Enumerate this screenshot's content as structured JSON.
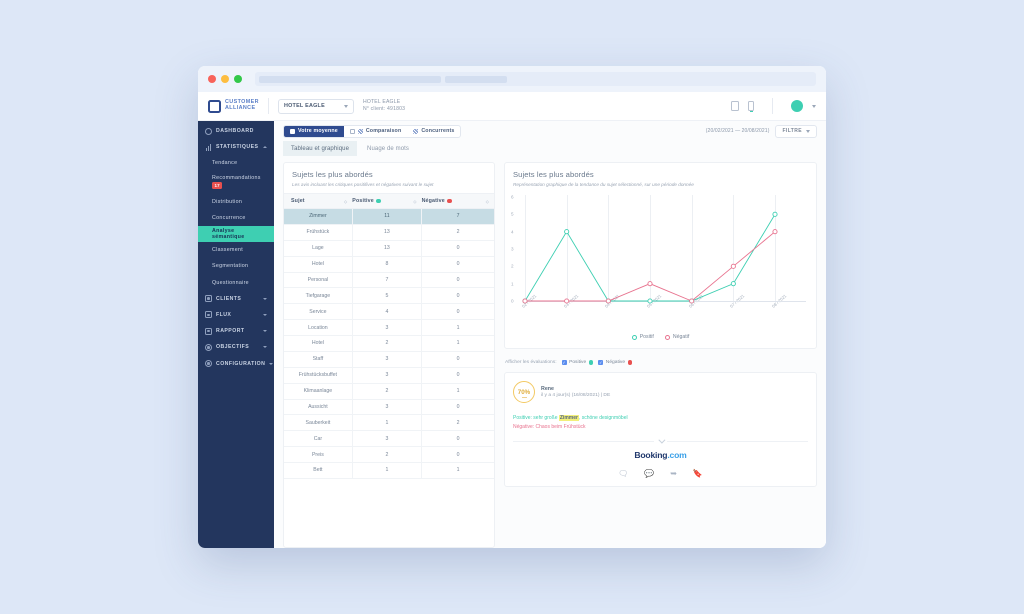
{
  "window": {
    "url_placeholder": ""
  },
  "topbar": {
    "logo_line1": "CUSTOMER",
    "logo_line2": "ALLIANCE",
    "hotel_selector": "HOTEL EAGLE",
    "hotel_name": "HOTEL EAGLE",
    "client_number": "N° client: 491803"
  },
  "sidebar": {
    "items": [
      {
        "label": "DASHBOARD",
        "icon": "dashboard-icon"
      },
      {
        "label": "STATISTIQUES",
        "icon": "chart-bars-icon"
      }
    ],
    "sub_items": [
      {
        "label": "Tendance"
      },
      {
        "label": "Recommandations",
        "badge": "17"
      },
      {
        "label": "Distribution"
      },
      {
        "label": "Concurrence"
      },
      {
        "label": "Analyse sémantique",
        "active": true
      },
      {
        "label": "Classement"
      },
      {
        "label": "Segmentation"
      },
      {
        "label": "Questionnaire"
      }
    ],
    "bottom_items": [
      {
        "label": "CLIENTS",
        "icon": "user-icon"
      },
      {
        "label": "FLUX",
        "icon": "flow-icon"
      },
      {
        "label": "RAPPORT",
        "icon": "report-icon"
      },
      {
        "label": "OBJECTIFS",
        "icon": "target-icon"
      },
      {
        "label": "CONFIGURATION",
        "icon": "gear-icon"
      }
    ]
  },
  "toolbar": {
    "segments": [
      {
        "label": "Votre moyenne",
        "active": true
      },
      {
        "label": "Comparaison",
        "active": false
      },
      {
        "label": "Concurrents",
        "active": false
      }
    ],
    "date_range": "(20/02/2021 — 20/08/2021)",
    "filter_label": "FILTRE"
  },
  "tabs": [
    {
      "label": "Tableau et graphique",
      "active": true
    },
    {
      "label": "Nuage de mots",
      "active": false
    }
  ],
  "table_panel": {
    "title": "Sujets les plus abordés",
    "subtitle": "Les avis incluant les critiques positifives et négatives suivant le sujet",
    "columns": [
      "Sujet",
      "Positive",
      "Négative"
    ],
    "rows": [
      {
        "subject": "Zimmer",
        "positive": "11",
        "negative": "7",
        "selected": true
      },
      {
        "subject": "Frühstück",
        "positive": "13",
        "negative": "2"
      },
      {
        "subject": "Lage",
        "positive": "13",
        "negative": "0"
      },
      {
        "subject": "Hotel",
        "positive": "8",
        "negative": "0"
      },
      {
        "subject": "Personal",
        "positive": "7",
        "negative": "0"
      },
      {
        "subject": "Tiefgarage",
        "positive": "5",
        "negative": "0"
      },
      {
        "subject": "Service",
        "positive": "4",
        "negative": "0"
      },
      {
        "subject": "Location",
        "positive": "3",
        "negative": "1"
      },
      {
        "subject": "Hotel",
        "positive": "2",
        "negative": "1"
      },
      {
        "subject": "Staff",
        "positive": "3",
        "negative": "0"
      },
      {
        "subject": "Frühstücksbuffet",
        "positive": "3",
        "negative": "0"
      },
      {
        "subject": "Klimaanlage",
        "positive": "2",
        "negative": "1"
      },
      {
        "subject": "Aussicht",
        "positive": "3",
        "negative": "0"
      },
      {
        "subject": "Sauberkeit",
        "positive": "1",
        "negative": "2"
      },
      {
        "subject": "Car",
        "positive": "3",
        "negative": "0"
      },
      {
        "subject": "Preis",
        "positive": "2",
        "negative": "0"
      },
      {
        "subject": "Bett",
        "positive": "1",
        "negative": "1"
      }
    ]
  },
  "chart_panel": {
    "title": "Sujets les plus abordés",
    "subtitle": "Représentation graphique de la tendance du sujet sélectionné, sur une période donnée",
    "legend": [
      {
        "label": "Positif"
      },
      {
        "label": "Négatif"
      }
    ],
    "eval_label": "Afficher les évaluations:",
    "eval_options": [
      {
        "label": "Positive",
        "checked": true
      },
      {
        "label": "Négative",
        "checked": true
      }
    ]
  },
  "chart_data": {
    "type": "line",
    "title": "Sujets les plus abordés",
    "xlabel": "",
    "ylabel": "",
    "x": [
      "02 / 2021",
      "03 / 2021",
      "04 / 2021",
      "05 / 2021",
      "06 / 2021",
      "07 / 2021",
      "08 / 2021"
    ],
    "ylim": [
      0,
      6
    ],
    "yticks": [
      0,
      1,
      2,
      3,
      4,
      5,
      6
    ],
    "grid": true,
    "legend_position": "bottom",
    "series": [
      {
        "name": "Positif",
        "color": "#3ecfb2",
        "values": [
          0,
          4,
          0,
          0,
          0,
          1,
          5
        ]
      },
      {
        "name": "Négatif",
        "color": "#e8738f",
        "values": [
          0,
          0,
          0,
          1,
          0,
          2,
          4
        ]
      }
    ]
  },
  "review": {
    "score": "70%",
    "name": "Rene",
    "meta": "il y a 4 jour(s) (16/08/2021) | DE",
    "positive_prefix": "Positive: ",
    "positive_before": "sehr große ",
    "positive_highlight": "Zimmer",
    "positive_after": ", schöne designmöbel",
    "negative_text": "Négative: Chaos beim Frühstück",
    "source_brand": "Booking",
    "source_tld": ".com",
    "actions": [
      "reply-icon",
      "comment-icon",
      "share-icon",
      "tag-icon"
    ]
  }
}
